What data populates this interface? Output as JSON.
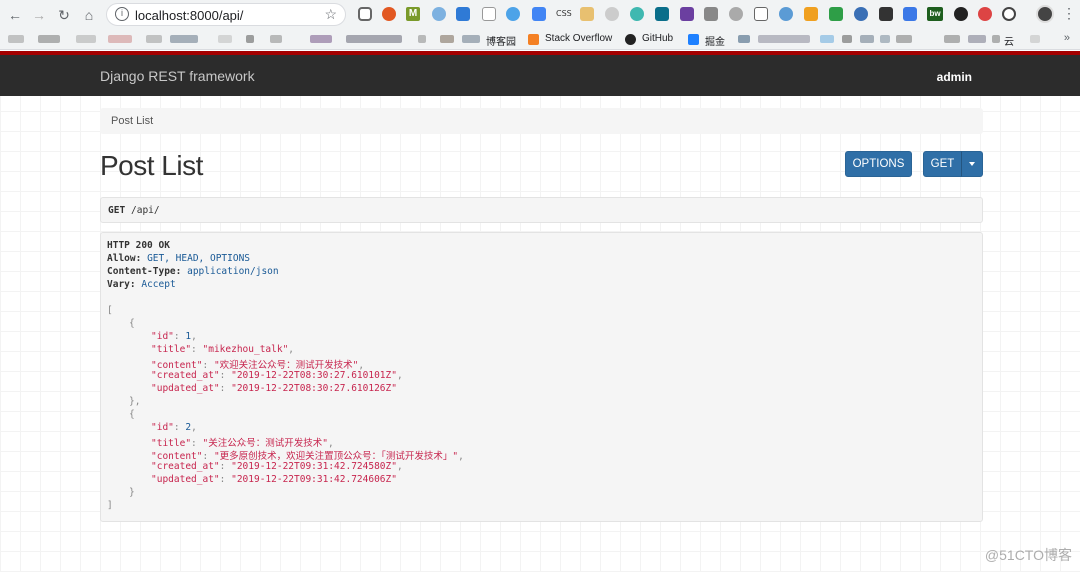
{
  "browser": {
    "url": "localhost:8000/api/",
    "bookmarks": [
      "博客园",
      "Stack Overflow",
      "GitHub",
      "掘金",
      "云"
    ],
    "extension_labels": {
      "m": "M",
      "css": "CSS",
      "bw": "bw"
    }
  },
  "app": {
    "brand": "Django REST framework",
    "user": "admin"
  },
  "breadcrumb": "Post List",
  "page_title": "Post List",
  "buttons": {
    "options": "OPTIONS",
    "get": "GET"
  },
  "request": {
    "method": "GET",
    "path": "/api/"
  },
  "response": {
    "status": "HTTP 200 OK",
    "headers": [
      {
        "name": "Allow:",
        "value": "GET, HEAD, OPTIONS"
      },
      {
        "name": "Content-Type:",
        "value": "application/json"
      },
      {
        "name": "Vary:",
        "value": "Accept"
      }
    ],
    "body": [
      {
        "id": "1",
        "title": "\"mikezhou_talk\"",
        "content": "\"欢迎关注公众号：测试开发技术\"",
        "created_at": "\"2019-12-22T08:30:27.610101Z\"",
        "updated_at": "\"2019-12-22T08:30:27.610126Z\""
      },
      {
        "id": "2",
        "title": "\"关注公众号：测试开发技术\"",
        "content": "\"更多原创技术，欢迎关注置顶公众号：「测试开发技术」\"",
        "created_at": "\"2019-12-22T09:31:42.724580Z\"",
        "updated_at": "\"2019-12-22T09:31:42.724606Z\""
      }
    ],
    "keys": {
      "id": "\"id\"",
      "title": "\"title\"",
      "content": "\"content\"",
      "created_at": "\"created_at\"",
      "updated_at": "\"updated_at\""
    }
  },
  "watermark": "@51CTO博客"
}
